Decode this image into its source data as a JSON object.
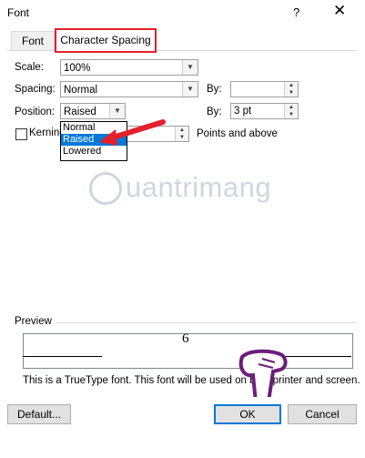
{
  "window": {
    "title": "Font",
    "help_glyph": "?",
    "close_glyph": "✕"
  },
  "tabs": [
    {
      "label": "Font",
      "active": false
    },
    {
      "label": "Character Spacing",
      "active": true
    }
  ],
  "fields": {
    "scale": {
      "label": "Scale:",
      "value": "100%"
    },
    "spacing": {
      "label": "Spacing:",
      "value": "Normal"
    },
    "spacing_by": {
      "label": "By:",
      "value": ""
    },
    "position": {
      "label": "Position:",
      "value": "Raised"
    },
    "position_by": {
      "label": "By:",
      "value": "3 pt"
    },
    "kerning": {
      "label": "Kerning",
      "checked": false,
      "suffix": "Points and above"
    }
  },
  "position_dropdown": {
    "options": [
      "Normal",
      "Raised",
      "Lowered"
    ],
    "selected": "Raised"
  },
  "watermark": "uantrimang",
  "preview": {
    "label": "Preview",
    "sample": "6",
    "note": "This is a TrueType font. This font will be used on both printer and screen."
  },
  "buttons": {
    "default": "Default...",
    "ok": "OK",
    "cancel": "Cancel"
  },
  "colors": {
    "highlight": "#e4202a",
    "selection": "#0078d7"
  }
}
